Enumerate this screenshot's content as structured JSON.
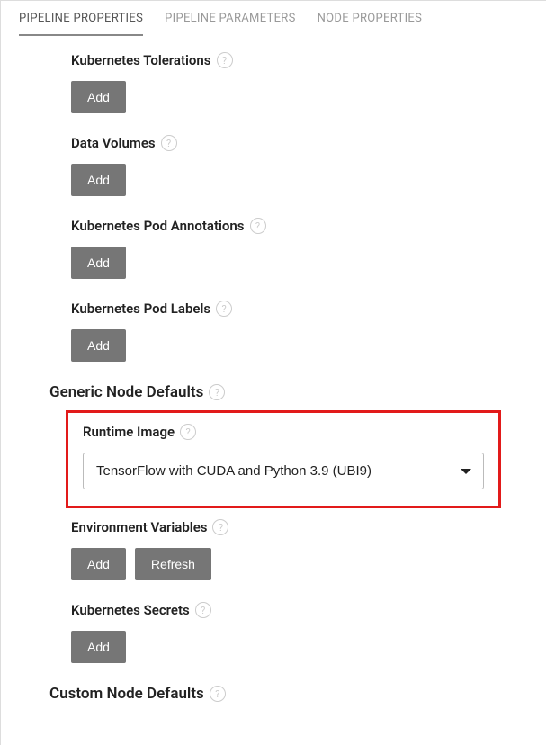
{
  "tabs": {
    "pipeline_properties": "PIPELINE PROPERTIES",
    "pipeline_parameters": "PIPELINE PARAMETERS",
    "node_properties": "NODE PROPERTIES"
  },
  "fields": {
    "kubernetes_tolerations": {
      "label": "Kubernetes Tolerations",
      "add": "Add"
    },
    "data_volumes": {
      "label": "Data Volumes",
      "add": "Add"
    },
    "kubernetes_pod_annotations": {
      "label": "Kubernetes Pod Annotations",
      "add": "Add"
    },
    "kubernetes_pod_labels": {
      "label": "Kubernetes Pod Labels",
      "add": "Add"
    },
    "runtime_image": {
      "label": "Runtime Image",
      "value": "TensorFlow with CUDA and Python 3.9 (UBI9)"
    },
    "environment_variables": {
      "label": "Environment Variables",
      "add": "Add",
      "refresh": "Refresh"
    },
    "kubernetes_secrets": {
      "label": "Kubernetes Secrets",
      "add": "Add"
    }
  },
  "sections": {
    "generic_node_defaults": "Generic Node Defaults",
    "custom_node_defaults": "Custom Node Defaults"
  },
  "help_glyph": "?"
}
